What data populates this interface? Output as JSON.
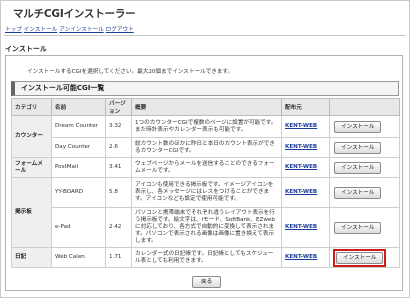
{
  "app": {
    "title": "マルチCGIインストーラー"
  },
  "nav": {
    "links": [
      "トップ",
      "インストール",
      "アンインストール",
      "ログアウト"
    ]
  },
  "page": {
    "heading": "インストール",
    "intro": "インストールするCGIを選択してください。最大20個までインストールできます。",
    "section_title": "インストール可能CGI一覧",
    "back_label": "戻る"
  },
  "table": {
    "headers": [
      "カテゴリ",
      "名前",
      "バージョン",
      "概要",
      "配布元",
      ""
    ],
    "categories": [
      "カウンター",
      "フォームメール",
      "掲示板",
      "日記"
    ],
    "rows": [
      {
        "name": "Dream Counter",
        "version": "3.32",
        "summary": "1つのカウンターCGIで複数のページに設置が可能です。また時計表示やカレンダー表示も可能です。",
        "source": "KENT-WEB",
        "action": "インストール"
      },
      {
        "name": "Day Counter",
        "version": "2.6",
        "summary": "総カウント数のほかに昨日と本日のカウント表示ができるカウンターCGIです。",
        "source": "KENT-WEB",
        "action": "インストール"
      },
      {
        "name": "PostMail",
        "version": "3.41",
        "summary": "ウェブページからメールを送信することのできるフォームメールです。",
        "source": "KENT-WEB",
        "action": "インストール"
      },
      {
        "name": "YY-BOARD",
        "version": "5.8",
        "summary": "アイコンも使用できる掲示板です。イメージアイコンを表示し、各メッセージにはレスをつけることができます。アイコンなども設定で使用可能です。",
        "source": "KENT-WEB",
        "action": "インストール"
      },
      {
        "name": "e-Pad",
        "version": "2.42",
        "summary": "パソコンと携帯端末でそれぞれ違うレイアウト表示を行う掲示板です。絵文字は、iモード、SoftBank、EZweb に対応しており、各方式で自動的に変換して表示されます。パソコンで表示される画像は画像に置き換えて表示します。",
        "source": "KENT-WEB",
        "action": "インストール"
      },
      {
        "name": "Web Calen",
        "version": "1.71",
        "summary": "カレンダー式の日記帳です。日記帳としてもスケジュール表としても利用できます。",
        "source": "KENT-WEB",
        "action": "インストール"
      }
    ]
  },
  "colors": {
    "link": "#1a3d99",
    "highlight": "#d11a1a",
    "header_bg": "#e8e8e8"
  }
}
